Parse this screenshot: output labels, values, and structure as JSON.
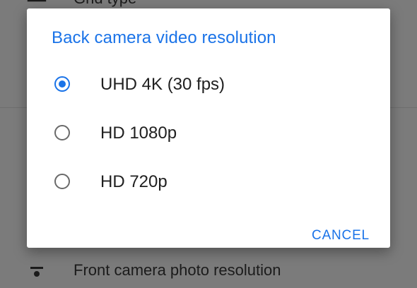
{
  "background": {
    "top_item": {
      "label": "Grid type",
      "icon": "grid-icon"
    },
    "bottom_item": {
      "label": "Front camera photo resolution",
      "icon": "person-icon"
    }
  },
  "dialog": {
    "title": "Back camera video resolution",
    "accent_color": "#1a73e8",
    "options": [
      {
        "label": "UHD 4K (30 fps)",
        "selected": true
      },
      {
        "label": "HD 1080p",
        "selected": false
      },
      {
        "label": "HD 720p",
        "selected": false
      }
    ],
    "cancel_label": "CANCEL"
  }
}
